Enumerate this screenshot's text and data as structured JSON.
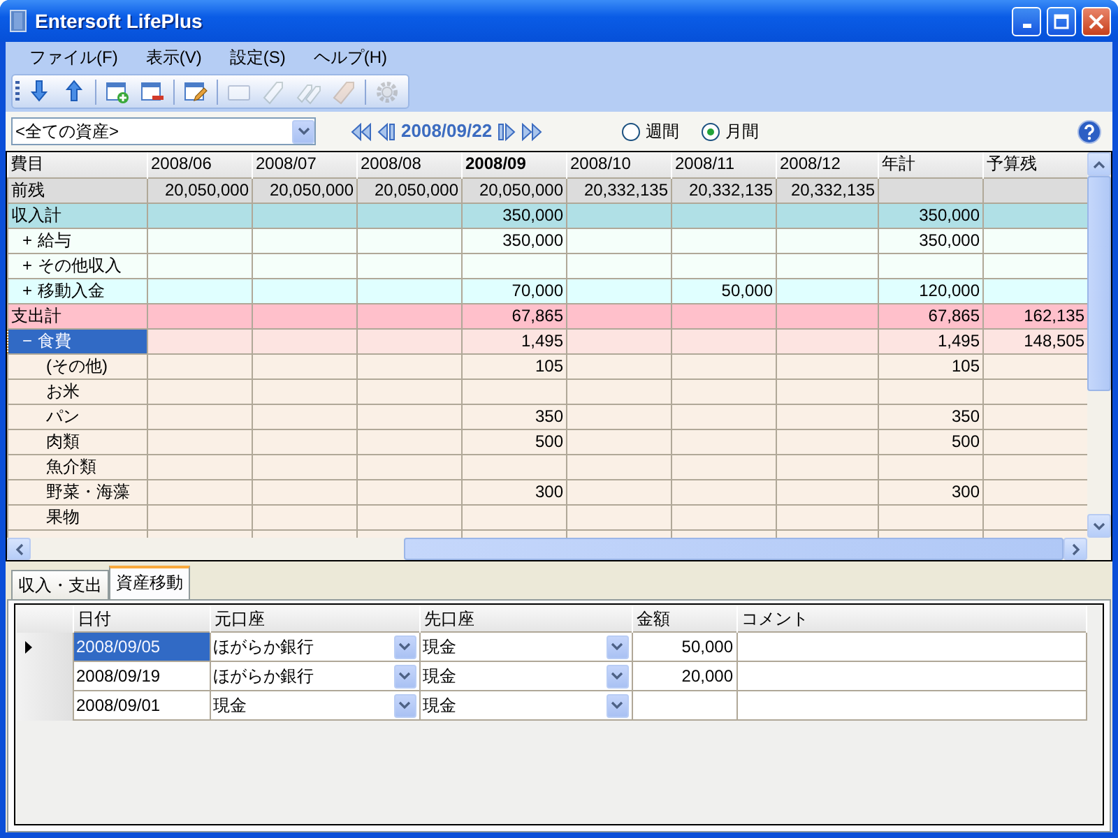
{
  "window": {
    "title": "Entersoft LifePlus"
  },
  "menu": [
    "ファイル(F)",
    "表示(V)",
    "設定(S)",
    "ヘルプ(H)"
  ],
  "toolbar": [
    {
      "kind": "down",
      "disabled": false
    },
    {
      "kind": "up",
      "disabled": false
    },
    {
      "kind": "add",
      "disabled": false
    },
    {
      "kind": "remove",
      "disabled": false
    },
    {
      "kind": "edit",
      "disabled": false
    },
    {
      "kind": "card",
      "disabled": true
    },
    {
      "kind": "tag",
      "disabled": true
    },
    {
      "kind": "tags",
      "disabled": true
    },
    {
      "kind": "ticket",
      "disabled": true
    },
    {
      "kind": "gear",
      "disabled": true
    }
  ],
  "asset_select": {
    "value": "<全ての資産>"
  },
  "date_nav": {
    "date": "2008/09/22"
  },
  "period": [
    {
      "label": "週間",
      "selected": false
    },
    {
      "label": "月間",
      "selected": true
    }
  ],
  "grid": {
    "label_header": "費目",
    "columns": [
      {
        "label": "2008/06",
        "current": false
      },
      {
        "label": "2008/07",
        "current": false
      },
      {
        "label": "2008/08",
        "current": false
      },
      {
        "label": "2008/09",
        "current": true
      },
      {
        "label": "2008/10",
        "current": false
      },
      {
        "label": "2008/11",
        "current": false
      },
      {
        "label": "2008/12",
        "current": false
      },
      {
        "label": "年計",
        "current": false
      },
      {
        "label": "予算残",
        "current": false
      }
    ],
    "rows": [
      {
        "kind": "balance",
        "label": "前残",
        "selected": false,
        "cells": [
          "20,050,000",
          "20,050,000",
          "20,050,000",
          "20,050,000",
          "20,332,135",
          "20,332,135",
          "20,332,135",
          null,
          null
        ]
      },
      {
        "kind": "income_total",
        "label": "収入計",
        "selected": false,
        "cells": [
          null,
          null,
          null,
          "350,000",
          null,
          null,
          null,
          "350,000",
          null
        ]
      },
      {
        "kind": "income_item",
        "toggle": "+",
        "label": "給与",
        "selected": false,
        "cells": [
          null,
          null,
          null,
          "350,000",
          null,
          null,
          null,
          "350,000",
          null
        ]
      },
      {
        "kind": "income_item",
        "toggle": "+",
        "label": "その他収入",
        "selected": false,
        "cells": [
          null,
          null,
          null,
          null,
          null,
          null,
          null,
          null,
          null
        ]
      },
      {
        "kind": "transfer",
        "toggle": "+",
        "label": "移動入金",
        "selected": false,
        "cells": [
          null,
          null,
          null,
          "70,000",
          null,
          "50,000",
          null,
          "120,000",
          null
        ]
      },
      {
        "kind": "expense_total",
        "label": "支出計",
        "selected": false,
        "cells": [
          null,
          null,
          null,
          "67,865",
          null,
          null,
          null,
          "67,865",
          "162,135"
        ]
      },
      {
        "kind": "expense_group",
        "toggle": "−",
        "label": "食費",
        "selected": true,
        "cells": [
          null,
          null,
          null,
          "1,495",
          null,
          null,
          null,
          "1,495",
          "148,505"
        ]
      },
      {
        "kind": "expense_item",
        "label": "(その他)",
        "selected": false,
        "cells": [
          null,
          null,
          null,
          "105",
          null,
          null,
          null,
          "105",
          null
        ]
      },
      {
        "kind": "expense_item",
        "label": "お米",
        "selected": false,
        "cells": [
          null,
          null,
          null,
          null,
          null,
          null,
          null,
          null,
          null
        ]
      },
      {
        "kind": "expense_item",
        "label": "パン",
        "selected": false,
        "cells": [
          null,
          null,
          null,
          "350",
          null,
          null,
          null,
          "350",
          null
        ]
      },
      {
        "kind": "expense_item",
        "label": "肉類",
        "selected": false,
        "cells": [
          null,
          null,
          null,
          "500",
          null,
          null,
          null,
          "500",
          null
        ]
      },
      {
        "kind": "expense_item",
        "label": "魚介類",
        "selected": false,
        "cells": [
          null,
          null,
          null,
          null,
          null,
          null,
          null,
          null,
          null
        ]
      },
      {
        "kind": "expense_item",
        "label": "野菜・海藻",
        "selected": false,
        "cells": [
          null,
          null,
          null,
          "300",
          null,
          null,
          null,
          "300",
          null
        ]
      },
      {
        "kind": "expense_item",
        "label": "果物",
        "selected": false,
        "cells": [
          null,
          null,
          null,
          null,
          null,
          null,
          null,
          null,
          null
        ]
      }
    ]
  },
  "tabs": [
    {
      "label": "収入・支出",
      "selected": false
    },
    {
      "label": "資産移動",
      "selected": true
    }
  ],
  "transfers": {
    "columns": [
      "日付",
      "元口座",
      "先口座",
      "金額",
      "コメント"
    ],
    "rows": [
      {
        "current": true,
        "date": "2008/09/05",
        "date_selected": true,
        "from": "ほがらか銀行",
        "to": "現金",
        "amount": "50,000"
      },
      {
        "current": false,
        "date": "2008/09/19",
        "date_selected": false,
        "from": "ほがらか銀行",
        "to": "現金",
        "amount": "20,000"
      },
      {
        "current": false,
        "date": "2008/09/01",
        "date_selected": false,
        "from": "現金",
        "to": "現金"
      }
    ]
  }
}
